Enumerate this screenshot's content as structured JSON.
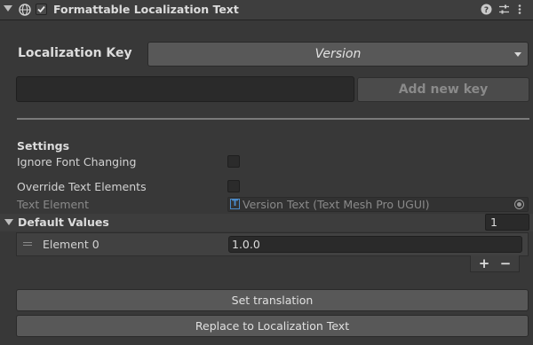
{
  "component": {
    "title": "Formattable Localization Text",
    "enabled": true,
    "icons": [
      "globe-icon",
      "help-icon",
      "presets-icon",
      "menu-icon"
    ]
  },
  "localization": {
    "key_label": "Localization Key",
    "key_value": "Version",
    "new_key_value": "",
    "add_key_label": "Add new key"
  },
  "settings": {
    "heading": "Settings",
    "ignore_font_label": "Ignore Font Changing",
    "ignore_font_checked": false,
    "override_label": "Override Text Elements",
    "override_checked": false,
    "text_element_label": "Text Element",
    "text_element_value": "Version Text (Text Mesh Pro UGUI)"
  },
  "default_values": {
    "label": "Default Values",
    "size": "1",
    "elements": [
      {
        "label": "Element 0",
        "value": "1.0.0"
      }
    ],
    "add_label": "+",
    "remove_label": "−"
  },
  "actions": {
    "set_translation": "Set translation",
    "replace": "Replace to Localization Text"
  },
  "colors": {
    "background": "#383838",
    "header": "#3e3e3e",
    "button": "#585858",
    "field": "#2a2a2a",
    "object_icon": "#4a8ac9"
  }
}
